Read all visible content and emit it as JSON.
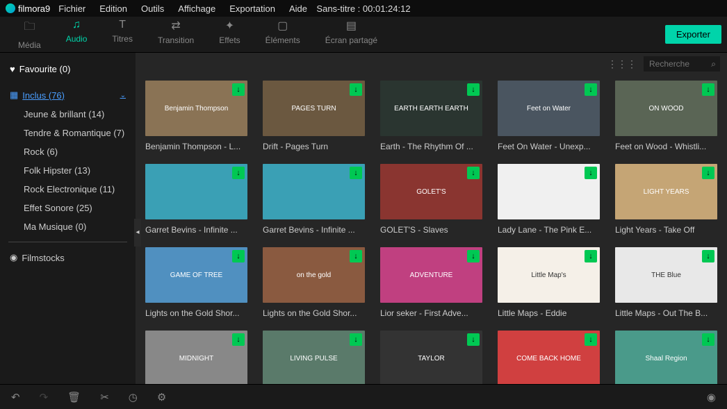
{
  "app": {
    "name": "filmora",
    "version": "9"
  },
  "title": "Sans-titre : 00:01:24:12",
  "menu": [
    "Fichier",
    "Edition",
    "Outils",
    "Affichage",
    "Exportation",
    "Aide"
  ],
  "tabs": [
    {
      "id": "media",
      "label": "Média",
      "icon": "folder"
    },
    {
      "id": "audio",
      "label": "Audio",
      "icon": "music",
      "active": true
    },
    {
      "id": "titres",
      "label": "Titres",
      "icon": "text"
    },
    {
      "id": "transition",
      "label": "Transition",
      "icon": "transition"
    },
    {
      "id": "effets",
      "label": "Effets",
      "icon": "effects"
    },
    {
      "id": "elements",
      "label": "Éléments",
      "icon": "elements"
    },
    {
      "id": "ecran",
      "label": "Écran partagé",
      "icon": "split"
    }
  ],
  "export_label": "Exporter",
  "sidebar": {
    "favourite": "Favourite (0)",
    "inclus": "Inclus (76)",
    "subs": [
      "Jeune & brillant (14)",
      "Tendre & Romantique (7)",
      "Rock (6)",
      "Folk Hipster (13)",
      "Rock Electronique (11)",
      "Effet Sonore (25)",
      "Ma Musique (0)"
    ],
    "filmstocks": "Filmstocks"
  },
  "search": {
    "placeholder": "Recherche"
  },
  "items": [
    {
      "title": "Benjamin Thompson - L...",
      "thumb": "Benjamin Thompson",
      "bg": "#8a7355"
    },
    {
      "title": "Drift - Pages Turn",
      "thumb": "PAGES TURN",
      "bg": "#6b5840"
    },
    {
      "title": "Earth - The Rhythm Of ...",
      "thumb": "EARTH EARTH EARTH",
      "bg": "#2a3530"
    },
    {
      "title": "Feet On Water - Unexp...",
      "thumb": "Feet on Water",
      "bg": "#4a5560"
    },
    {
      "title": "Feet on Wood - Whistli...",
      "thumb": "ON WOOD",
      "bg": "#5a6555"
    },
    {
      "title": "Garret Bevins - Infinite ...",
      "thumb": "",
      "bg": "#3aa0b5"
    },
    {
      "title": "Garret Bevins - Infinite ...",
      "thumb": "",
      "bg": "#3aa0b5"
    },
    {
      "title": "GOLET'S - Slaves",
      "thumb": "GOLET'S",
      "bg": "#8a3530"
    },
    {
      "title": "Lady Lane - The Pink E...",
      "thumb": "",
      "bg": "#f0f0f0"
    },
    {
      "title": "Light Years - Take Off",
      "thumb": "LIGHT YEARS",
      "bg": "#c5a575"
    },
    {
      "title": "Lights on the Gold Shor...",
      "thumb": "GAME OF TREE",
      "bg": "#5090c0"
    },
    {
      "title": "Lights on the Gold Shor...",
      "thumb": "on the gold",
      "bg": "#8a5a40"
    },
    {
      "title": "Lior seker - First Adve...",
      "thumb": "ADVENTURE",
      "bg": "#c04080"
    },
    {
      "title": "Little Maps - Eddie",
      "thumb": "Little Map's",
      "bg": "#f5f0e8"
    },
    {
      "title": "Little Maps - Out The B...",
      "thumb": "THE Blue",
      "bg": "#e8e8e8"
    },
    {
      "title": "",
      "thumb": "MIDNIGHT",
      "bg": "#888"
    },
    {
      "title": "",
      "thumb": "LIVING PULSE",
      "bg": "#5a7a6a"
    },
    {
      "title": "",
      "thumb": "TAYLOR",
      "bg": "#333"
    },
    {
      "title": "",
      "thumb": "COME BACK HOME",
      "bg": "#d04040"
    },
    {
      "title": "",
      "thumb": "Shaal Region",
      "bg": "#4a9a8a"
    }
  ]
}
